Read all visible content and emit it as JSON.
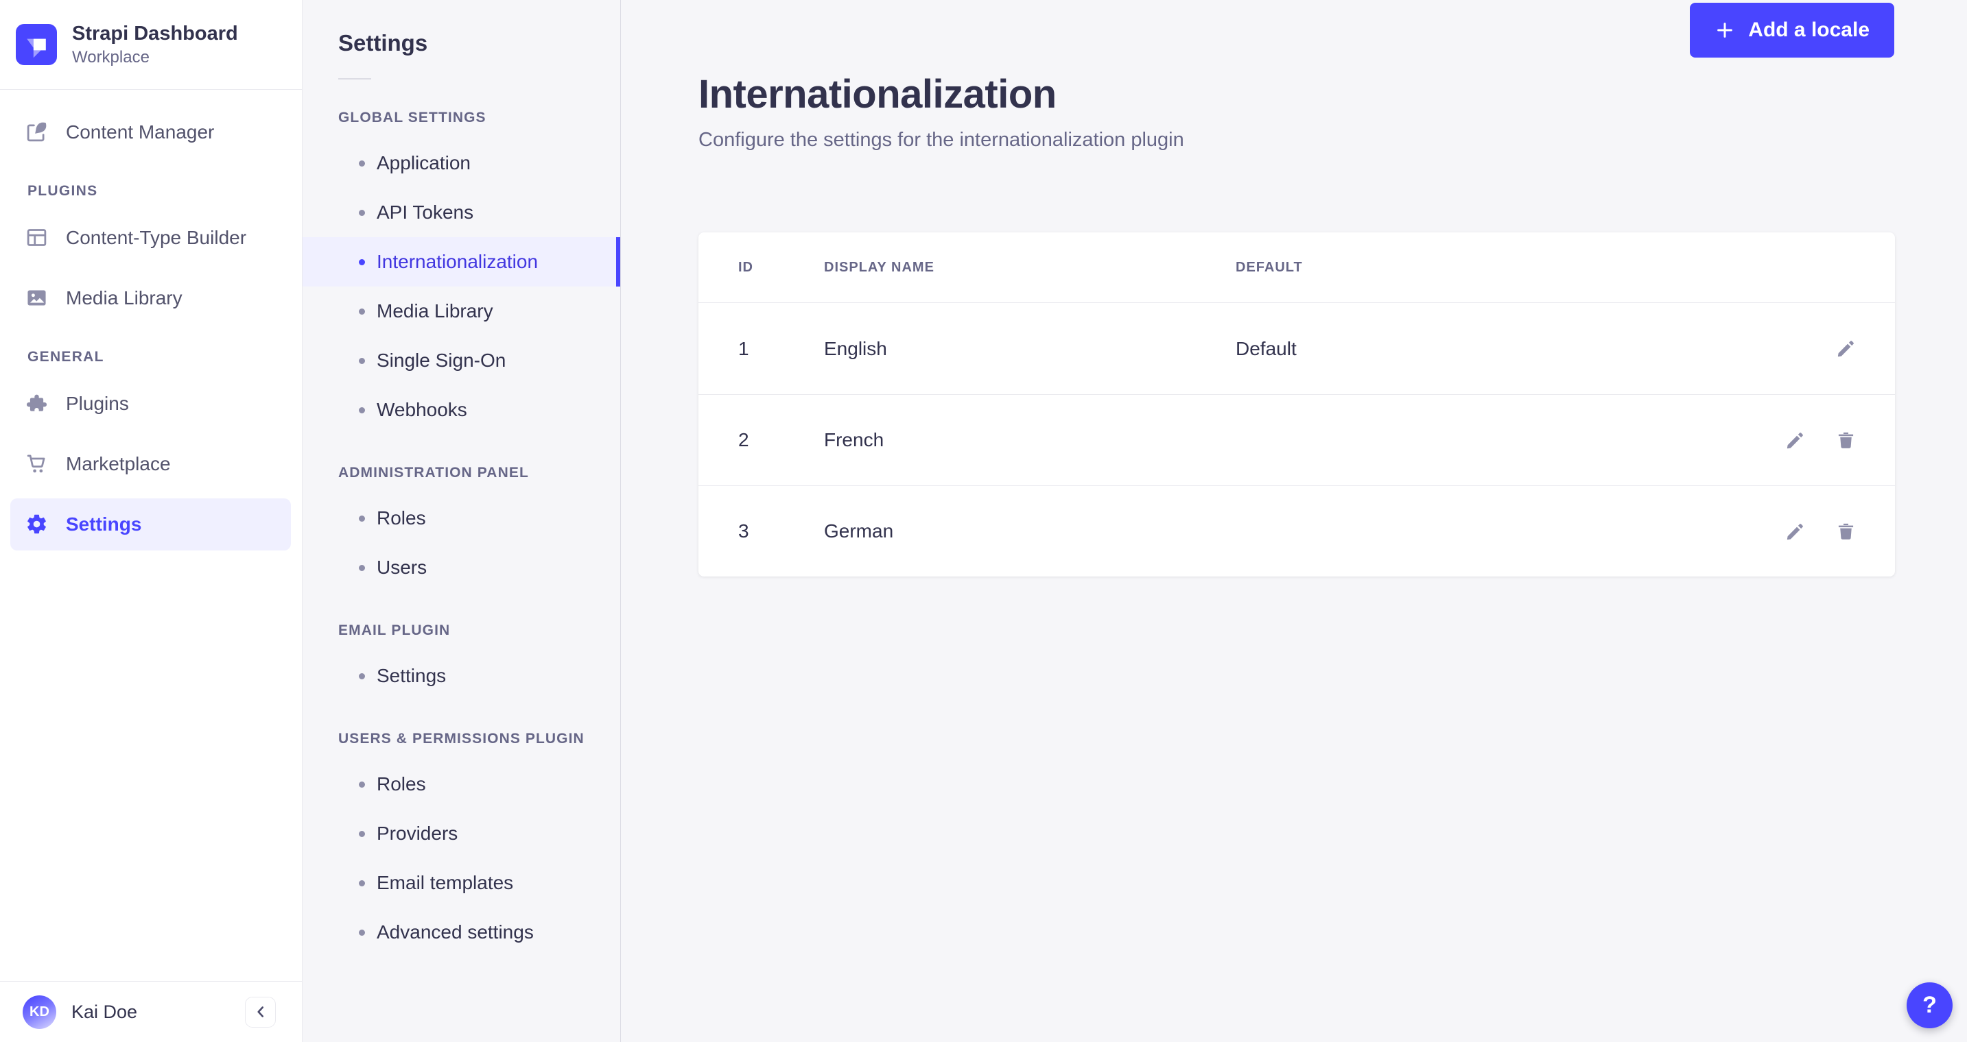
{
  "colors": {
    "primary": "#4945ff",
    "primary_light_bg": "#f0f0ff",
    "text_dark": "#32324d",
    "text_muted": "#666687",
    "icon_muted": "#8e8ea9",
    "border": "#eaeaef",
    "panel_bg": "#f6f6f9"
  },
  "brand": {
    "title": "Strapi Dashboard",
    "subtitle": "Workplace",
    "logo_icon": "strapi-logo"
  },
  "sidebar": {
    "sections": [
      {
        "label": "",
        "items": [
          {
            "label": "Content Manager",
            "icon": "content-manager-icon",
            "active": false
          }
        ]
      },
      {
        "label": "PLUGINS",
        "items": [
          {
            "label": "Content-Type Builder",
            "icon": "content-type-builder-icon",
            "active": false
          },
          {
            "label": "Media Library",
            "icon": "media-library-icon",
            "active": false
          }
        ]
      },
      {
        "label": "GENERAL",
        "items": [
          {
            "label": "Plugins",
            "icon": "plugins-icon",
            "active": false
          },
          {
            "label": "Marketplace",
            "icon": "marketplace-icon",
            "active": false
          },
          {
            "label": "Settings",
            "icon": "settings-icon",
            "active": true
          }
        ]
      }
    ],
    "user": {
      "name": "Kai Doe",
      "initials": "KD"
    },
    "collapse_icon": "chevron-left-icon"
  },
  "subnav": {
    "title": "Settings",
    "groups": [
      {
        "label": "GLOBAL SETTINGS",
        "items": [
          {
            "label": "Application",
            "active": false
          },
          {
            "label": "API Tokens",
            "active": false
          },
          {
            "label": "Internationalization",
            "active": true
          },
          {
            "label": "Media Library",
            "active": false
          },
          {
            "label": "Single Sign-On",
            "active": false
          },
          {
            "label": "Webhooks",
            "active": false
          }
        ]
      },
      {
        "label": "ADMINISTRATION PANEL",
        "items": [
          {
            "label": "Roles",
            "active": false
          },
          {
            "label": "Users",
            "active": false
          }
        ]
      },
      {
        "label": "EMAIL PLUGIN",
        "items": [
          {
            "label": "Settings",
            "active": false
          }
        ]
      },
      {
        "label": "USERS & PERMISSIONS PLUGIN",
        "items": [
          {
            "label": "Roles",
            "active": false
          },
          {
            "label": "Providers",
            "active": false
          },
          {
            "label": "Email templates",
            "active": false
          },
          {
            "label": "Advanced settings",
            "active": false
          }
        ]
      }
    ]
  },
  "main": {
    "title": "Internationalization",
    "subtitle": "Configure the settings for the internationalization plugin",
    "add_button": {
      "label": "Add a locale",
      "icon": "plus-icon"
    },
    "table": {
      "headers": [
        "ID",
        "DISPLAY NAME",
        "DEFAULT"
      ],
      "rows": [
        {
          "id": "1",
          "display_name": "English",
          "default": "Default",
          "actions": [
            "edit"
          ]
        },
        {
          "id": "2",
          "display_name": "French",
          "default": "",
          "actions": [
            "edit",
            "delete"
          ]
        },
        {
          "id": "3",
          "display_name": "German",
          "default": "",
          "actions": [
            "edit",
            "delete"
          ]
        }
      ]
    }
  },
  "help_button": {
    "label": "?"
  }
}
